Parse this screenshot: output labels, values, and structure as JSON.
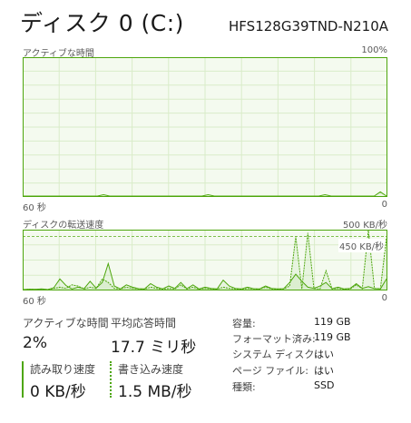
{
  "header": {
    "title": "ディスク 0 (C:)",
    "model": "HFS128G39TND-N210A"
  },
  "colors": {
    "accent": "#4da60c",
    "grid": "#d9ecc9",
    "fill": "#f4faef"
  },
  "chart_data": [
    {
      "type": "line",
      "title": "アクティブな時間",
      "y_max_label": "100%",
      "x_left_label": "60 秒",
      "x_right_label": "0",
      "ylim": [
        0,
        100
      ],
      "series": [
        {
          "values": [
            0,
            0,
            0,
            0,
            0,
            0,
            0,
            0,
            0,
            0,
            0,
            0,
            0,
            1,
            0,
            0,
            0,
            0,
            0,
            0,
            0,
            0,
            0,
            0,
            0,
            0,
            0,
            0,
            0,
            0,
            1,
            0,
            0,
            0,
            0,
            0,
            0,
            0,
            0,
            0,
            0,
            0,
            0,
            0,
            0,
            0,
            0,
            0,
            0,
            1,
            0,
            0,
            0,
            0,
            0,
            0,
            0,
            0,
            3,
            0
          ]
        }
      ]
    },
    {
      "type": "line",
      "title": "ディスクの転送速度",
      "y_max_label": "500 KB/秒",
      "x_left_label": "60 秒",
      "x_right_label": "0",
      "reference_label": "450 KB/秒",
      "ylim": [
        0,
        500
      ],
      "series": [
        {
          "values": [
            0,
            3,
            2,
            5,
            0,
            15,
            90,
            35,
            5,
            20,
            8,
            70,
            12,
            60,
            220,
            30,
            5,
            40,
            20,
            8,
            5,
            50,
            20,
            6,
            30,
            10,
            60,
            8,
            40,
            5,
            20,
            10,
            5,
            80,
            30,
            10,
            5,
            20,
            8,
            5,
            30,
            10,
            5,
            8,
            60,
            130,
            70,
            20,
            10,
            30,
            60,
            8,
            20,
            5,
            10,
            50,
            10,
            25,
            8,
            5,
            90
          ]
        },
        {
          "values": [
            0,
            2,
            1,
            3,
            0,
            10,
            20,
            10,
            40,
            30,
            5,
            20,
            10,
            90,
            60,
            10,
            5,
            20,
            10,
            5,
            3,
            20,
            10,
            4,
            10,
            5,
            40,
            5,
            20,
            3,
            10,
            5,
            3,
            20,
            10,
            5,
            3,
            10,
            5,
            3,
            20,
            5,
            3,
            5,
            30,
            450,
            5,
            480,
            10,
            5,
            160,
            5,
            10,
            3,
            5,
            40,
            8,
            500,
            10,
            8,
            440
          ]
        }
      ]
    }
  ],
  "stats": {
    "active_time": {
      "label": "アクティブな時間",
      "value": "2%"
    },
    "response_time": {
      "label": "平均応答時間",
      "value": "17.7 ミリ秒"
    },
    "read_speed": {
      "label": "読み取り速度",
      "value": "0 KB/秒"
    },
    "write_speed": {
      "label": "書き込み速度",
      "value": "1.5 MB/秒"
    }
  },
  "properties": [
    {
      "label": "容量:",
      "value": "119 GB"
    },
    {
      "label": "フォーマット済み:",
      "value": "119 GB"
    },
    {
      "label": "システム ディスク:",
      "value": "はい"
    },
    {
      "label": "ページ ファイル:",
      "value": "はい"
    },
    {
      "label": "種類:",
      "value": "SSD"
    }
  ]
}
